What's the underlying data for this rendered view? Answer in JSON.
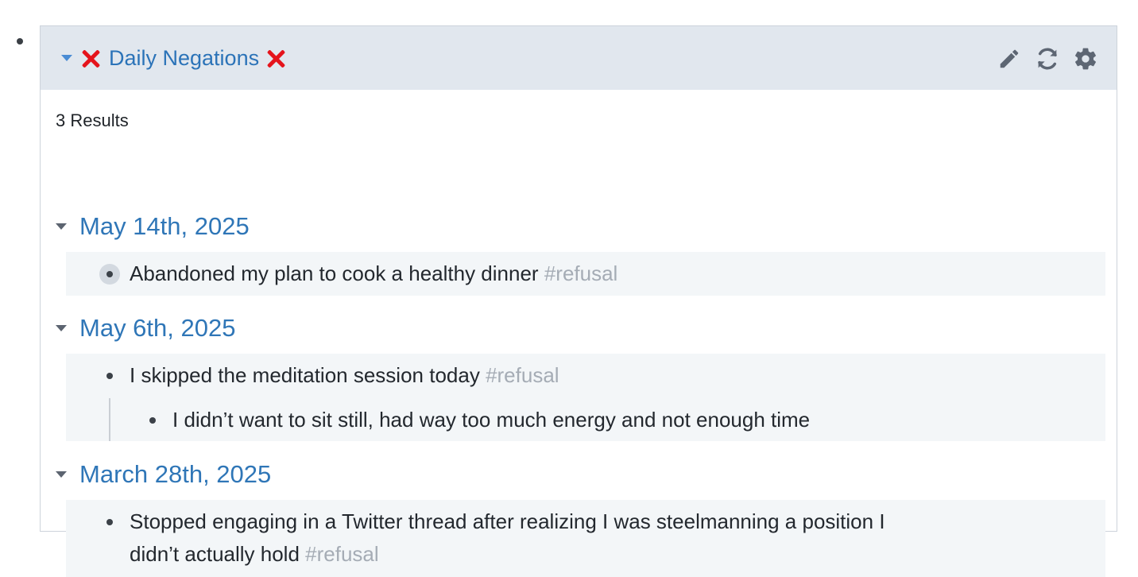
{
  "query": {
    "title": "Daily Negations",
    "icons": [
      "caret-down-icon",
      "cross-mark-icon",
      "pencil-icon",
      "refresh-icon",
      "gear-icon"
    ],
    "results_count": "3 Results"
  },
  "groups": [
    {
      "date": "May 14th, 2025",
      "items": [
        {
          "text": "Abandoned my plan to cook a healthy dinner",
          "tag": "#refusal"
        }
      ]
    },
    {
      "date": "May 6th, 2025",
      "items": [
        {
          "text": "I skipped the meditation session today",
          "tag": "#refusal",
          "children": [
            {
              "text": "I didn’t want to sit still, had way too much energy and not enough time"
            }
          ]
        }
      ]
    },
    {
      "date": "March 28th, 2025",
      "items": [
        {
          "text_line1": "Stopped engaging in a Twitter thread after realizing I was steelmanning a position I",
          "text_line2": "didn’t actually hold",
          "tag": "#refusal"
        }
      ]
    }
  ],
  "colors": {
    "header_bg": "#e1e7ee",
    "link_blue": "#2f76b7",
    "cross_red": "#e5141c",
    "tag_gray": "#a5acb5",
    "item_bg": "#f3f6f8"
  }
}
